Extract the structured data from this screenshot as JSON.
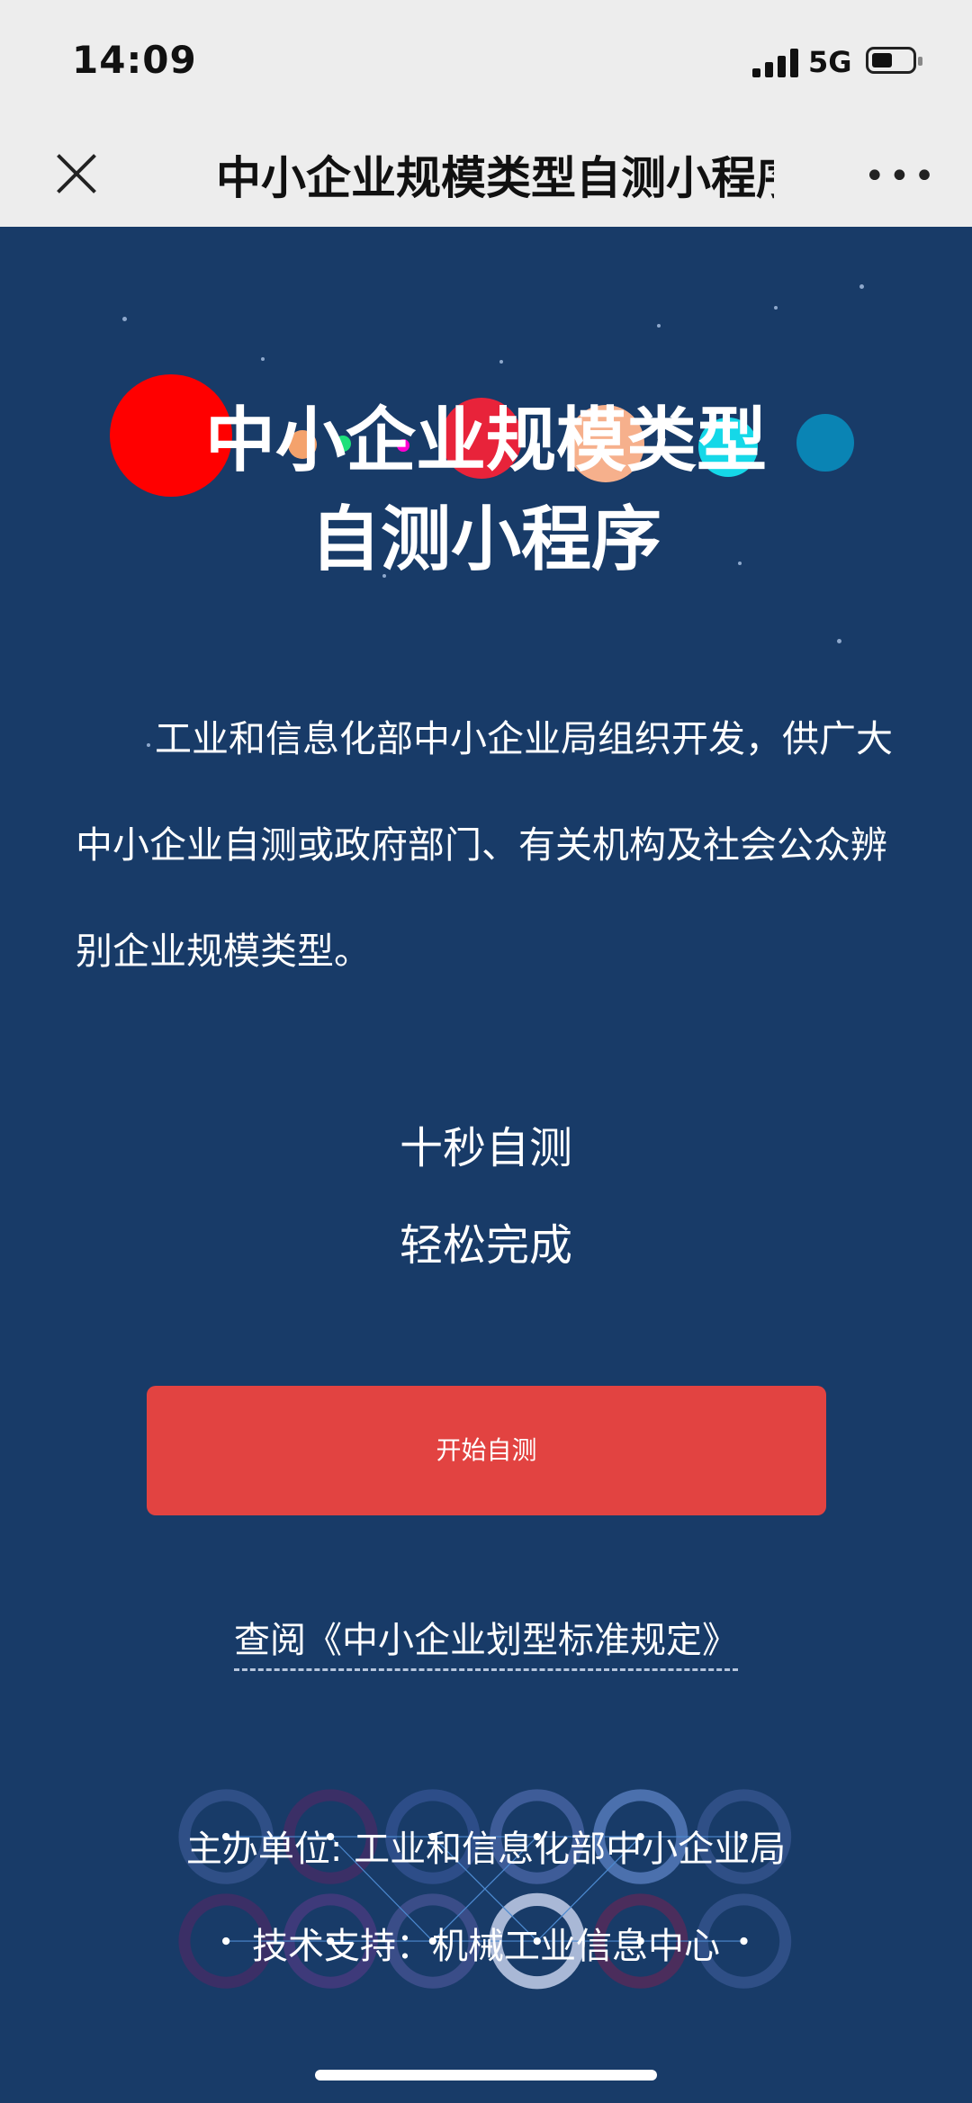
{
  "status_bar": {
    "time": "14:09",
    "network": "5G",
    "battery_level": 0.45
  },
  "navbar": {
    "title": "中小企业规模类型自测小程序",
    "close_icon": "close-icon",
    "more_icon": "more-dots-icon"
  },
  "hero": {
    "title_line1": "中小企业规模类型",
    "title_line2": "自测小程序"
  },
  "intro": {
    "text": "工业和信息化部中小企业局组织开发，供广大中小企业自测或政府部门、有关机构及社会公众辨别企业规模类型。"
  },
  "taglines": [
    "十秒自测",
    "轻松完成"
  ],
  "start_button": {
    "label": "开始自测"
  },
  "standard_link": {
    "label": "查阅《中小企业划型标准规定》"
  },
  "footer": {
    "organizer": "主办单位: 工业和信息化部中小企业局",
    "tech_support": "技术支持：机械工业信息中心"
  },
  "colors": {
    "background": "#183b68",
    "button": "#e24341",
    "topbar": "#ededed"
  }
}
